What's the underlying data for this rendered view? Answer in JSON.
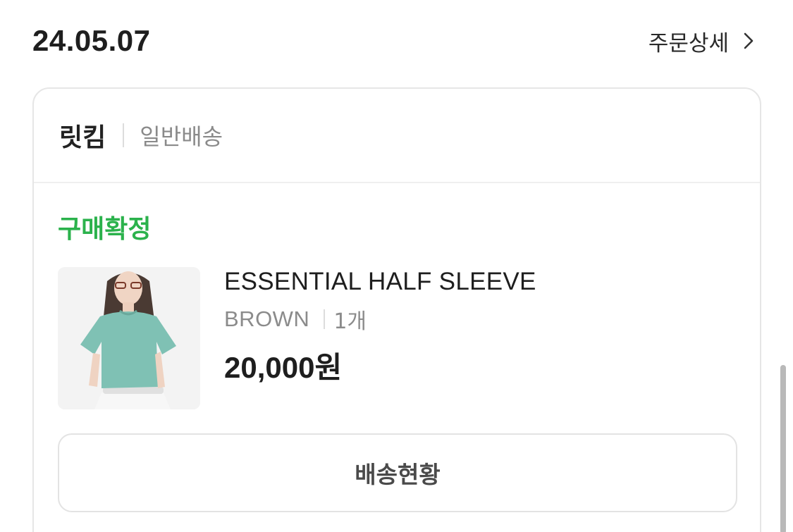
{
  "order": {
    "date": "24.05.07",
    "detail_label": "주문상세"
  },
  "seller": {
    "name": "릿킴",
    "delivery_type": "일반배송"
  },
  "status": {
    "label": "구매확정",
    "color": "#2bb24c"
  },
  "product": {
    "name": "ESSENTIAL HALF SLEEVE",
    "option_color": "BROWN",
    "quantity": "1개",
    "price": "20,000원",
    "image_icon": "product-photo"
  },
  "actions": {
    "track_label": "배송현황"
  },
  "icons": {
    "detail_chevron": "chevron-right-icon"
  }
}
